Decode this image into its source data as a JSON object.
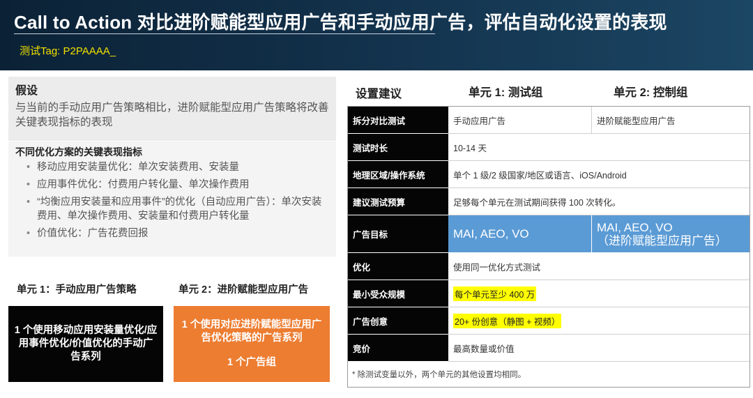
{
  "header": {
    "title": "Call to Action 对比进阶赋能型应用广告和手动应用广告，评估自动化设置的表现",
    "tag": "测试Tag: P2PAAAA_"
  },
  "hypothesis": {
    "title": "假设",
    "text": "与当前的手动应用广告策略相比，进阶赋能型应用广告策略将改善关键表现指标的表现"
  },
  "kpis": {
    "title": "不同优化方案的关键表现指标",
    "items": [
      "移动应用安装量优化：单次安装费用、安装量",
      "应用事件优化：付费用户转化量、单次操作费用",
      "“均衡应用安装量和应用事件”的优化（自动应用广告）：单次安装费用、单次操作费用、安装量和付费用户转化量",
      "价值优化：广告花费回报"
    ]
  },
  "units": {
    "unit1_label": "单元 1：手动应用广告策略",
    "unit2_label": "单元 2：进阶赋能型应用广告",
    "unit1_box": "1 个使用移动应用安装量优化/应用事件优化/价值优化的手动广告系列",
    "unit2_box_line1": "1 个使用对应进阶赋能型应用广告优化策略的广告系列",
    "unit2_box_line2": "1 个广告组"
  },
  "setup": {
    "col_headers": [
      "设置建议",
      "单元 1: 测试组",
      "单元 2: 控制组"
    ],
    "rows": [
      {
        "label": "拆分对比测试",
        "u1": "手动应用广告",
        "u2": "进阶赋能型应用广告"
      },
      {
        "label": "测试时长",
        "value": "10-14 天"
      },
      {
        "label": "地理区域/操作系统",
        "value": "单个 1 级/2 级国家/地区或语言、iOS/Android"
      },
      {
        "label": "建议测试预算",
        "value": "足够每个单元在测试期间获得 100 次转化。"
      },
      {
        "label": "广告目标",
        "u1": "MAI, AEO, VO",
        "u2_line1": "MAI, AEO, VO",
        "u2_line2": "（进阶赋能型应用广告）"
      },
      {
        "label": "优化",
        "value": "使用同一优化方式测试"
      },
      {
        "label": "最小受众规模",
        "value": "每个单元至少 400 万"
      },
      {
        "label": "广告创意",
        "value": "20+ 份创意（静图 + 视频）"
      },
      {
        "label": "竞价",
        "value": "最高数量或价值"
      }
    ],
    "note": "* 除测试变量以外，两个单元的其他设置均相同。"
  },
  "colors": {
    "header_bg": "#12304a",
    "tag_yellow": "#f2e100",
    "unit2_orange": "#ed7d31",
    "goal_blue": "#5b9bd5",
    "highlight": "#ffff00"
  }
}
